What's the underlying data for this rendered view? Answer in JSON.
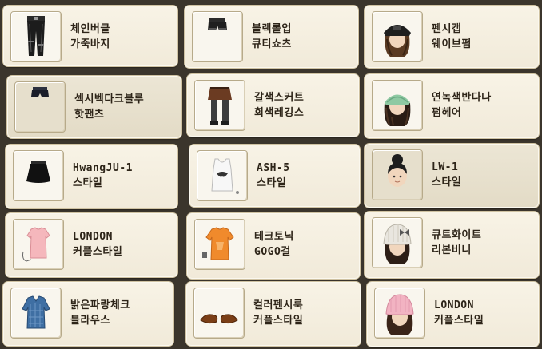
{
  "items": [
    {
      "line1": "체인버클",
      "line2": "가죽바지",
      "icon": "leather-pants-icon"
    },
    {
      "line1": "블랙롤업",
      "line2": "큐티쇼츠",
      "icon": "black-shorts-icon"
    },
    {
      "line1": "펜시캡",
      "line2": "웨이브펌",
      "icon": "cap-wave-hair-icon"
    },
    {
      "line1": "섹시벡다크블루",
      "line2": "핫팬츠",
      "icon": "hot-pants-icon"
    },
    {
      "line1": "갈색스커트",
      "line2": "회색레깅스",
      "icon": "skirt-leggings-icon"
    },
    {
      "line1": "연녹색반다나",
      "line2": "펌헤어",
      "icon": "bandana-perm-hair-icon"
    },
    {
      "line1": "HwangJU-1",
      "line2": "스타일",
      "icon": "black-skirt-icon"
    },
    {
      "line1": "ASH-5",
      "line2": "스타일",
      "icon": "white-tank-top-icon"
    },
    {
      "line1": "LW-1",
      "line2": "스타일",
      "icon": "bun-hair-face-icon"
    },
    {
      "line1": "LONDON",
      "line2": "커플스타일",
      "icon": "pink-top-icon"
    },
    {
      "line1": "테크토닉",
      "line2": "GOGO걸",
      "icon": "orange-tshirt-icon"
    },
    {
      "line1": "큐트화이트",
      "line2": "리본비니",
      "icon": "white-beanie-icon"
    },
    {
      "line1": "밝은파랑체크",
      "line2": "블라우스",
      "icon": "blue-check-blouse-icon"
    },
    {
      "line1": "컬러펜시룩",
      "line2": "커플스타일",
      "icon": "brown-shoes-icon"
    },
    {
      "line1": "LONDON",
      "line2": "커플스타일",
      "icon": "pink-beanie-icon"
    }
  ],
  "colors": {
    "background": "#3b352c",
    "card": "#f5efe0",
    "text": "#2d2418"
  }
}
